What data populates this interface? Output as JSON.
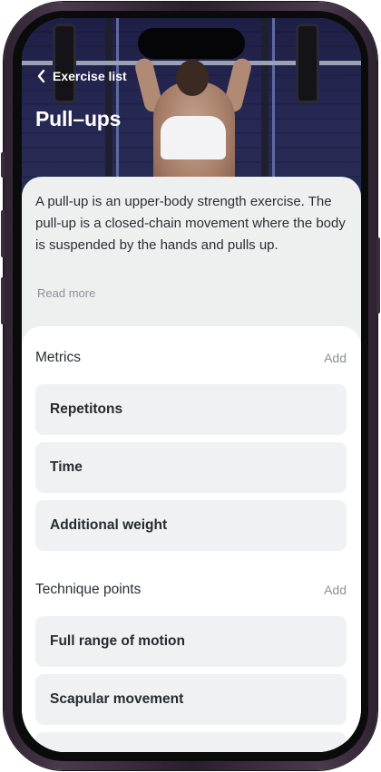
{
  "header": {
    "back_label": "Exercise list",
    "title": "Pull–ups"
  },
  "description": {
    "text": "A pull-up is an upper-body strength exercise. The pull-up is a closed-chain movement where the body is suspended by the hands and pulls up.",
    "read_more": "Read more"
  },
  "metrics": {
    "title": "Metrics",
    "add_label": "Add",
    "items": [
      {
        "label": "Repetitons"
      },
      {
        "label": "Time"
      },
      {
        "label": "Additional weight"
      }
    ]
  },
  "technique": {
    "title": "Technique points",
    "add_label": "Add",
    "items": [
      {
        "label": "Full range of motion"
      },
      {
        "label": "Scapular movement"
      }
    ]
  },
  "colors": {
    "background": "#f2f4f4",
    "card": "#eff1f2",
    "text": "#2a2f33",
    "muted": "#8b9196",
    "device_frame": "#3b2c3d"
  },
  "icons": {
    "back": "chevron-left-icon"
  }
}
